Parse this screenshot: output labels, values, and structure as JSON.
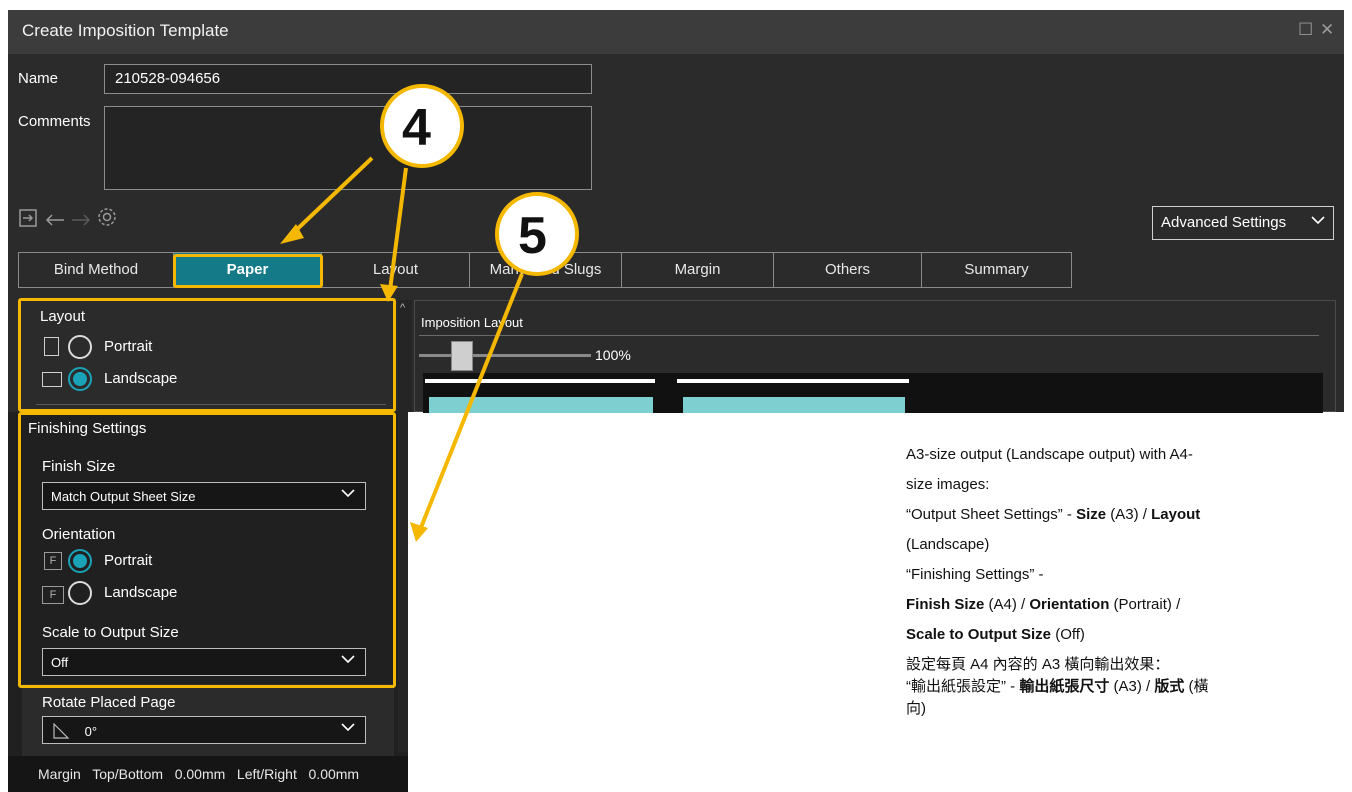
{
  "window": {
    "title": "Create Imposition Template",
    "controls": [
      "☐",
      "✕"
    ]
  },
  "form": {
    "name_label": "Name",
    "name_value": "210528-094656",
    "comments_label": "Comments",
    "comments_value": ""
  },
  "toolbar": {
    "icons": [
      "import-icon",
      "undo-icon",
      "redo-icon",
      "settings-icon"
    ]
  },
  "advanced_settings": {
    "label": "Advanced Settings"
  },
  "tabs": [
    {
      "label": "Bind Method",
      "active": false
    },
    {
      "label": "Paper",
      "active": true
    },
    {
      "label": "Layout",
      "active": false
    },
    {
      "label": "Marks and Slugs",
      "active": false
    },
    {
      "label": "Margin",
      "active": false
    },
    {
      "label": "Others",
      "active": false
    },
    {
      "label": "Summary",
      "active": false
    }
  ],
  "layout_section": {
    "heading": "Layout",
    "portrait_label": "Portrait",
    "landscape_label": "Landscape",
    "selected": "Landscape"
  },
  "imposition_layout": {
    "heading": "Imposition Layout",
    "zoom": "100%"
  },
  "finishing": {
    "heading": "Finishing Settings",
    "finish_size_label": "Finish Size",
    "finish_size_value": "Match Output Sheet Size",
    "orientation_label": "Orientation",
    "portrait_label": "Portrait",
    "landscape_label": "Landscape",
    "orientation_selected": "Portrait",
    "scale_label": "Scale to Output Size",
    "scale_value": "Off",
    "rotate_label": "Rotate Placed Page",
    "rotate_value": "0°",
    "margin_text": "Margin   Top/Bottom   0.00mm   Left/Right   0.00mm"
  },
  "callouts": {
    "step4": "4",
    "step5": "5"
  },
  "notes": {
    "line1": "A3-size output (Landscape output) with A4-",
    "line2": "size images:",
    "line3_pre": "“Output Sheet Settings” - ",
    "line3_b1": "Size",
    "line3_mid": " (A3) / ",
    "line3_b2": "Layout",
    "line4": "(Landscape)",
    "line5": "“Finishing Settings” -",
    "line6_b1": "Finish Size",
    "line6_mid1": " (A4) / ",
    "line6_b2": "Orientation",
    "line6_mid2": " (Portrait) /",
    "line7_b1": "Scale to Output Size",
    "line7_rest": " (Off)",
    "zh1": "設定每頁 A4 內容的 A3 橫向輸出效果：",
    "zh2_pre": "“輸出紙張設定” - ",
    "zh2_b1": "輸出紙張尺寸",
    "zh2_mid": " (A3) / ",
    "zh2_b2": "版式",
    "zh2_rest": " (橫",
    "zh3": "向)"
  },
  "colors": {
    "accent": "#157a88",
    "highlight": "#f5b800",
    "radio_on": "#1aa3b8"
  }
}
